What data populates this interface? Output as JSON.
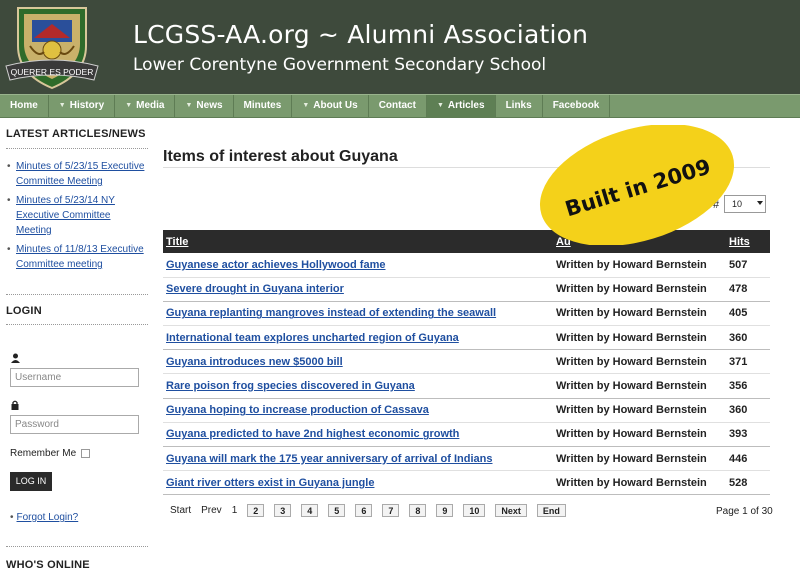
{
  "header": {
    "title": "LCGSS-AA.org ~ Alumni Association",
    "subtitle": "Lower Corentyne Government Secondary School",
    "logo_motto": "QUERER ES PODER"
  },
  "nav": [
    {
      "label": "Home",
      "arrow": false
    },
    {
      "label": "History",
      "arrow": true
    },
    {
      "label": "Media",
      "arrow": true
    },
    {
      "label": "News",
      "arrow": true
    },
    {
      "label": "Minutes",
      "arrow": false
    },
    {
      "label": "About Us",
      "arrow": true
    },
    {
      "label": "Contact",
      "arrow": false
    },
    {
      "label": "Articles",
      "arrow": true,
      "active": true
    },
    {
      "label": "Links",
      "arrow": false
    },
    {
      "label": "Facebook",
      "arrow": false
    }
  ],
  "sidebar": {
    "latest_heading": "LATEST ARTICLES/NEWS",
    "latest_items": [
      "Minutes of 5/23/15 Executive Committee Meeting",
      "Minutes of 5/23/14 NY Executive Committee Meeting",
      "Minutes of 11/8/13 Executive Committee meeting"
    ],
    "login_heading": "LOGIN",
    "username_placeholder": "Username",
    "password_placeholder": "Password",
    "remember_label": "Remember Me",
    "login_button": "LOG IN",
    "forgot_link": "Forgot Login?",
    "who_heading": "WHO'S ONLINE"
  },
  "main": {
    "heading": "Items of interest about Guyana",
    "display_hash": "#",
    "display_limit": "10",
    "stamp_text": "Built in 2009",
    "columns": {
      "title": "Title",
      "author": "Au",
      "hits": "Hits"
    },
    "rows": [
      {
        "title": "Guyanese actor achieves Hollywood fame",
        "author": "Written by Howard Bernstein",
        "hits": "507"
      },
      {
        "title": "Severe drought in Guyana interior",
        "author": "Written by Howard Bernstein",
        "hits": "478"
      },
      {
        "title": "Guyana replanting mangroves instead of extending the seawall",
        "author": "Written by Howard Bernstein",
        "hits": "405"
      },
      {
        "title": "International team explores uncharted region of Guyana",
        "author": "Written by Howard Bernstein",
        "hits": "360"
      },
      {
        "title": "Guyana introduces new $5000 bill",
        "author": "Written by Howard Bernstein",
        "hits": "371"
      },
      {
        "title": "Rare poison frog species discovered in Guyana",
        "author": "Written by Howard Bernstein",
        "hits": "356"
      },
      {
        "title": "Guyana hoping to increase production of Cassava",
        "author": "Written by Howard Bernstein",
        "hits": "360"
      },
      {
        "title": "Guyana predicted to have 2nd highest economic growth",
        "author": "Written by Howard Bernstein",
        "hits": "393"
      },
      {
        "title": "Guyana will mark the 175 year anniversary of arrival of Indians",
        "author": "Written by Howard Bernstein",
        "hits": "446"
      },
      {
        "title": "Giant river otters exist in Guyana jungle",
        "author": "Written by Howard Bernstein",
        "hits": "528"
      }
    ],
    "pager": {
      "start": "Start",
      "prev": "Prev",
      "current": "1",
      "pages": [
        "2",
        "3",
        "4",
        "5",
        "6",
        "7",
        "8",
        "9",
        "10"
      ],
      "next": "Next",
      "end": "End",
      "page_count": "Page 1 of 30"
    }
  },
  "colors": {
    "header_bg": "#3e4a3c",
    "nav_bg": "#7a9a6e",
    "link": "#1f4fa0",
    "stamp_yellow": "#f4d11a"
  }
}
